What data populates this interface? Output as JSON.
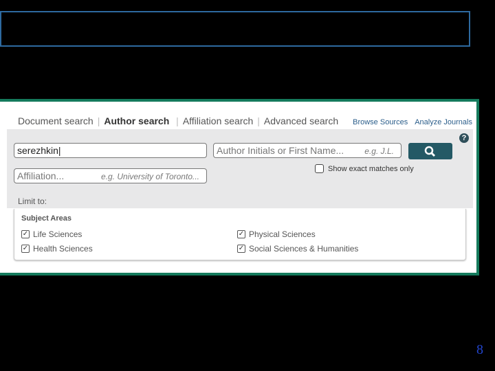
{
  "tabs": [
    {
      "label": "Document search"
    },
    {
      "label": "Author search",
      "active": true
    },
    {
      "label": "Affiliation search"
    },
    {
      "label": "Advanced search"
    }
  ],
  "links": {
    "browse": "Browse Sources",
    "analyze": "Analyze Journals"
  },
  "form": {
    "last_name_value": "serezhkin",
    "initials_placeholder": "Author Initials or First Name...",
    "initials_hint": "e.g. J.L.",
    "affiliation_placeholder": "Affiliation...",
    "affiliation_hint": "e.g. University of Toronto...",
    "exact_label": "Show exact matches only",
    "exact_checked": false,
    "help": "?",
    "limit_label": "Limit to:"
  },
  "subject": {
    "title": "Subject Areas",
    "items": [
      {
        "label": "Life Sciences",
        "checked": true
      },
      {
        "label": "Health Sciences",
        "checked": true
      },
      {
        "label": "Physical Sciences",
        "checked": true
      },
      {
        "label": "Social Sciences & Humanities",
        "checked": true
      }
    ]
  },
  "slide": {
    "page_number": "8"
  },
  "colors": {
    "accent": "#245965",
    "frame": "#147a5c",
    "title_box": "#2e6aa0",
    "page_number": "#2244cc"
  }
}
